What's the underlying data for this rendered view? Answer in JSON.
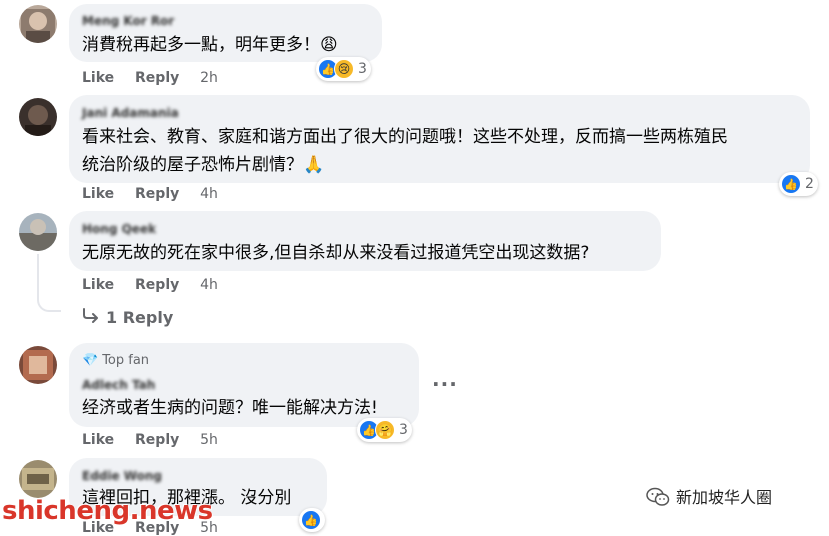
{
  "comments": [
    {
      "author": "Meng Kor Ror",
      "text": "消費稅再起多一點，明年更多！😩",
      "like": "Like",
      "reply": "Reply",
      "time": "2h",
      "reactions": {
        "icons": [
          "like-icon",
          "sad-icon"
        ],
        "count": "3"
      }
    },
    {
      "author": "Jani Adamania",
      "text_lines": [
        "看来社会、教育、家庭和谐方面出了很大的问题哦！这些不处理，反而搞一些两栋殖民",
        "统治阶级的屋子恐怖片剧情？🙏"
      ],
      "like": "Like",
      "reply": "Reply",
      "time": "4h",
      "reactions": {
        "icons": [
          "like-icon"
        ],
        "count": "2"
      }
    },
    {
      "author": "Hong Qeek",
      "text": "无原无故的死在家中很多,但自杀却从来没看过报道凭空出现这数据?",
      "like": "Like",
      "reply": "Reply",
      "time": "4h",
      "replies_label": "1 Reply"
    },
    {
      "badge": "Top fan",
      "author": "Adlech Tah",
      "text": "经济或者生病的问题？唯一能解决方法!",
      "like": "Like",
      "reply": "Reply",
      "time": "5h",
      "reactions": {
        "icons": [
          "like-icon",
          "care-icon"
        ],
        "count": "3"
      },
      "more": "···"
    },
    {
      "author": "Eddie Wong",
      "text": "這裡回扣，那裡漲。 沒分別",
      "like": "Like",
      "reply": "Reply",
      "time": "5h",
      "reactions": {
        "icons": [
          "like-icon"
        ],
        "count": ""
      }
    }
  ],
  "watermark": "shicheng.news",
  "brand": "新加坡华人圈",
  "colors": {
    "bubble": "#f0f2f5",
    "like_blue": "#1877f2",
    "meta_gray": "#65676b",
    "watermark_red": "#d9362a"
  }
}
